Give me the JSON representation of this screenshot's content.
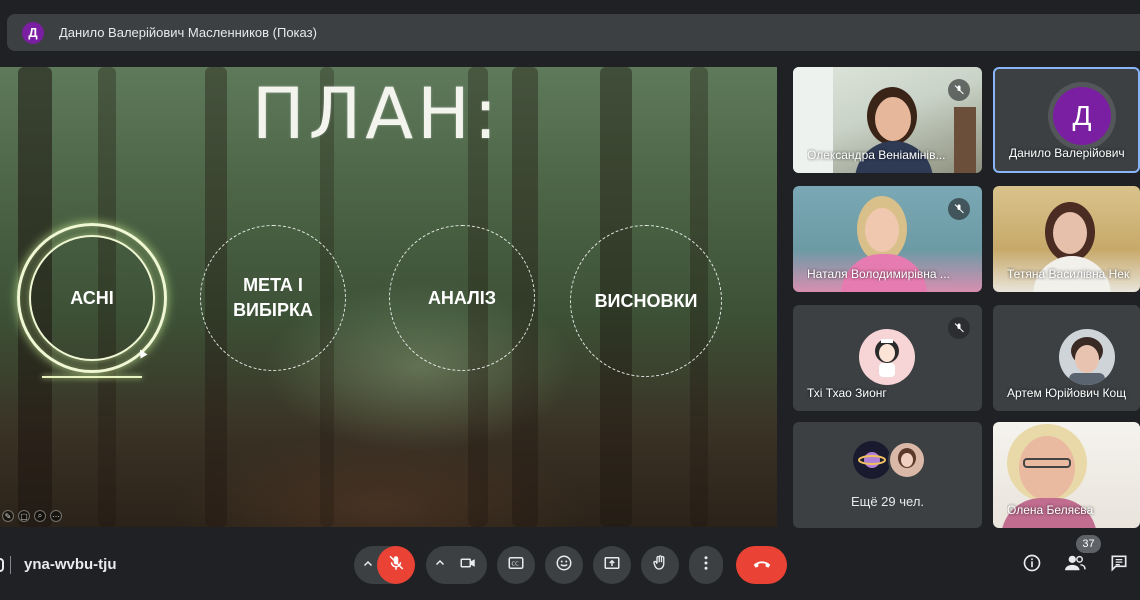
{
  "presenter": {
    "avatar_initial": "Д",
    "title": "Данило Валерійович Масленников (Показ)"
  },
  "slide": {
    "title": "ПЛАН:",
    "items": [
      {
        "label": "АСНІ",
        "active": true
      },
      {
        "label": "МЕТА І ВИБІРКА",
        "active": false
      },
      {
        "label": "АНАЛІЗ",
        "active": false
      },
      {
        "label": "ВИСНОВКИ",
        "active": false
      }
    ]
  },
  "participants": [
    {
      "name": "Олександра Веніамінів...",
      "muted": true
    },
    {
      "name": "Данило Валерійович",
      "muted": false,
      "avatar_initial": "Д",
      "avatar_color": "#7b1fa2"
    },
    {
      "name": "Наталя Володимирівна ...",
      "muted": true
    },
    {
      "name": "Тетяна Василівна Нек",
      "muted": false
    },
    {
      "name": "Тхі Тхао Зионг",
      "muted": true
    },
    {
      "name": "Артем Юрійович Кощ",
      "muted": false
    },
    {
      "name": "Олена Беляєва",
      "muted": false
    }
  ],
  "more_participants": "Ещё 29 чел.",
  "bottom_bar": {
    "meeting_code": "yna-wvbu-tju",
    "participants_count": "37"
  },
  "colors": {
    "end_call": "#ea4335",
    "mic_off": "#ea4335",
    "active_tile_border": "#8ab4f8",
    "panel": "#3c4043"
  }
}
